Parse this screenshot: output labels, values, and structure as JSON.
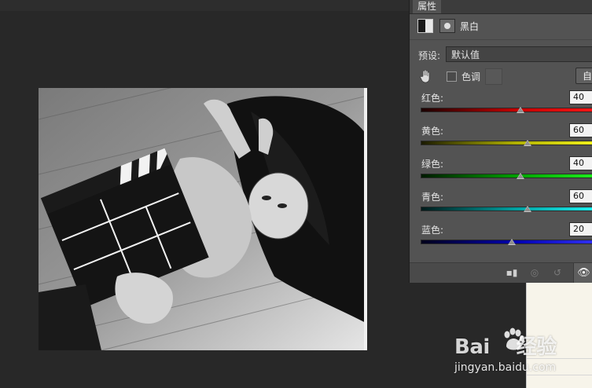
{
  "panel": {
    "tab_label": "属性",
    "adjustment_title": "黑白",
    "preset_label": "预设:",
    "preset_value": "默认值",
    "tint_label": "色调",
    "auto_button": "自",
    "sliders": [
      {
        "label": "红色:",
        "value": "40",
        "fraction": 0.57,
        "gradient": "linear-gradient(90deg,#1a0000,#c40000,#ff1a1a)"
      },
      {
        "label": "黄色:",
        "value": "60",
        "fraction": 0.61,
        "gradient": "linear-gradient(90deg,#1a1a00,#b0b000,#ffff22)"
      },
      {
        "label": "绿色:",
        "value": "40",
        "fraction": 0.57,
        "gradient": "linear-gradient(90deg,#001a00,#00a000,#22ff22)"
      },
      {
        "label": "青色:",
        "value": "60",
        "fraction": 0.61,
        "gradient": "linear-gradient(90deg,#001a1a,#00a0a0,#22ffff)"
      },
      {
        "label": "蓝色:",
        "value": "20",
        "fraction": 0.52,
        "gradient": "linear-gradient(90deg,#00001a,#0000b0,#3a3aff)"
      }
    ]
  },
  "watermark": {
    "brand": "Bai",
    "brand_suffix": "经验",
    "url": "jingyan.baidu.com"
  },
  "icons": [
    "bw-adjustment-icon",
    "mask-icon",
    "target-adjust-hand-icon",
    "clip-to-layer-icon",
    "view-previous-icon",
    "reset-icon",
    "visibility-eye-icon"
  ]
}
